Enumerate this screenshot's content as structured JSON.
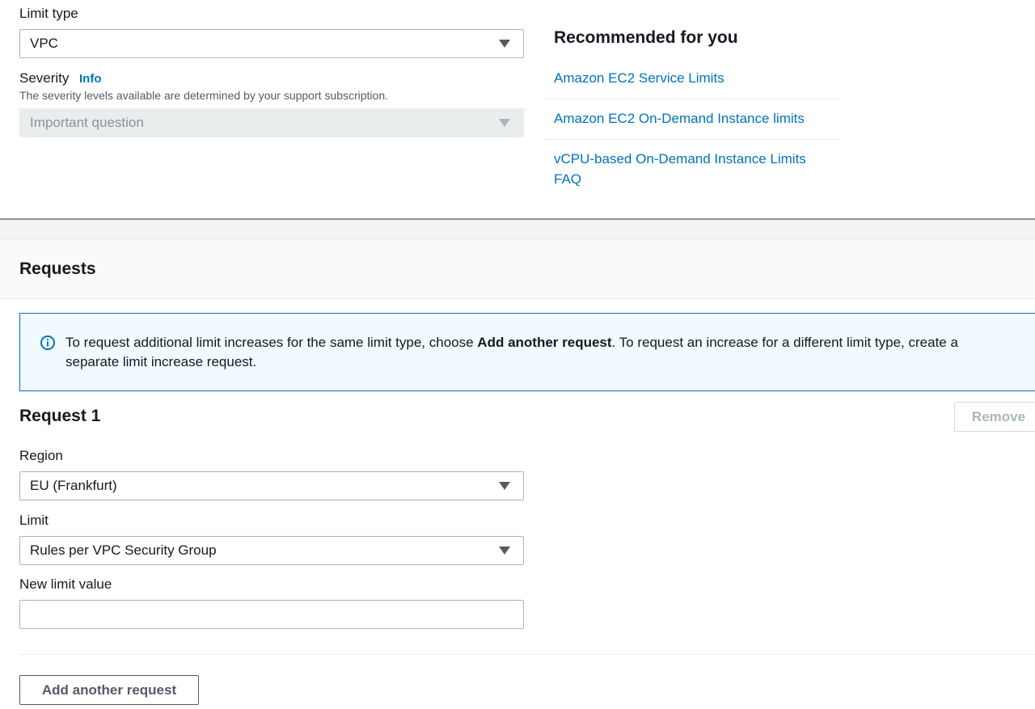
{
  "case_form": {
    "limit_type": {
      "label": "Limit type",
      "value": "VPC"
    },
    "severity": {
      "label": "Severity",
      "info_link": "Info",
      "description": "The severity levels available are determined by your support subscription.",
      "value": "Important question"
    }
  },
  "recommended": {
    "title": "Recommended for you",
    "links": [
      {
        "label": "Amazon EC2 Service Limits"
      },
      {
        "label": "Amazon EC2 On-Demand Instance limits"
      },
      {
        "label": "vCPU-based On-Demand Instance Limits FAQ"
      }
    ]
  },
  "requests": {
    "title": "Requests",
    "alert": {
      "text_before": "To request additional limit increases for the same limit type, choose ",
      "bold": "Add another request",
      "text_after": ". To request an increase for a different limit type, create a separate limit increase request."
    },
    "request1": {
      "title": "Request 1",
      "remove_label": "Remove",
      "region": {
        "label": "Region",
        "value": "EU (Frankfurt)"
      },
      "limit": {
        "label": "Limit",
        "value": "Rules per VPC Security Group"
      },
      "new_limit_value": {
        "label": "New limit value",
        "value": "",
        "placeholder": ""
      }
    },
    "add_request_label": "Add another request"
  },
  "colors": {
    "link": "#0073bb",
    "alert_bg": "#f1faff",
    "alert_border": "#0073bb",
    "text": "#16191f",
    "muted": "#545b64"
  }
}
